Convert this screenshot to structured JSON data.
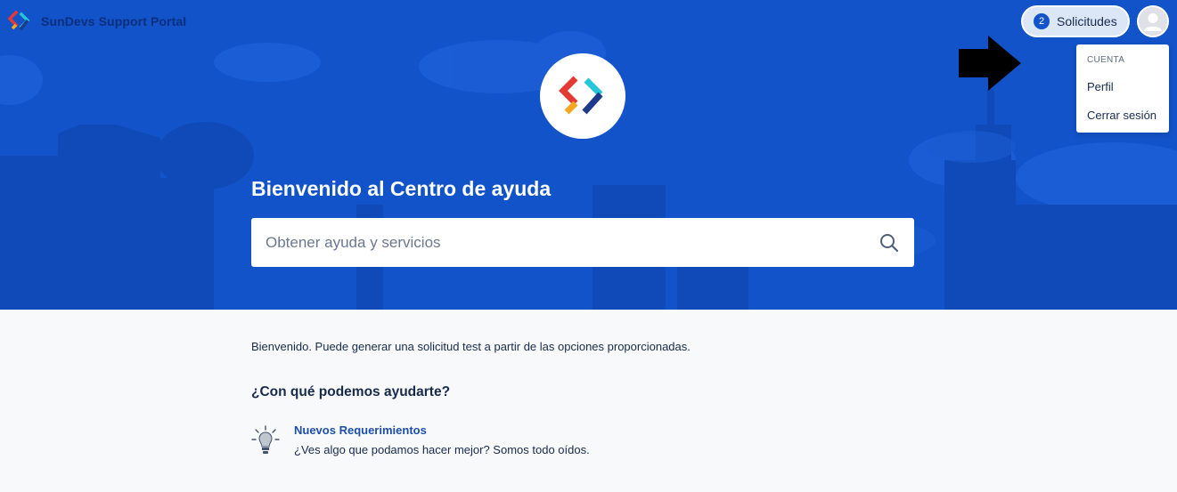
{
  "header": {
    "brand_name": "SunDevs Support Portal",
    "requests": {
      "count": "2",
      "label": "Solicitudes"
    }
  },
  "account_menu": {
    "section_label": "CUENTA",
    "items": [
      "Perfil",
      "Cerrar sesión"
    ]
  },
  "hero": {
    "title": "Bienvenido al Centro de ayuda",
    "search_placeholder": "Obtener ayuda y servicios"
  },
  "content": {
    "intro": "Bienvenido. Puede generar una solicitud test a partir de las opciones proporcionadas.",
    "heading": "¿Con qué podemos ayudarte?",
    "request_types": [
      {
        "title": "Nuevos Requerimientos",
        "description": "¿Ves algo que podamos hacer mejor? Somos todo oídos.",
        "icon": "lightbulb-icon"
      }
    ]
  },
  "colors": {
    "hero_bg": "#1253c9",
    "accent": "#1253c9",
    "link": "#1d4fa8",
    "page_bg": "#f8f9fa"
  }
}
